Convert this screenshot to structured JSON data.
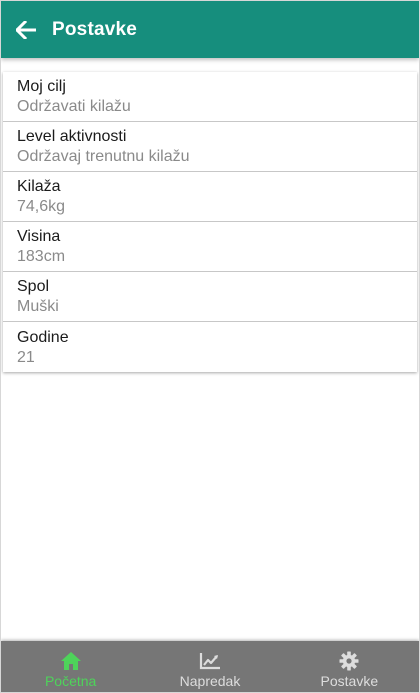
{
  "header": {
    "title": "Postavke",
    "back_icon": "arrow-left-icon"
  },
  "settings": [
    {
      "label": "Moj cilj",
      "value": "Održavati kilažu"
    },
    {
      "label": "Level aktivnosti",
      "value": "Održavaj trenutnu kilažu"
    },
    {
      "label": "Kilaža",
      "value": "74,6kg"
    },
    {
      "label": "Visina",
      "value": "183cm"
    },
    {
      "label": "Spol",
      "value": "Muški"
    },
    {
      "label": "Godine",
      "value": "21"
    }
  ],
  "bottom_nav": [
    {
      "label": "Početna",
      "icon": "home-icon",
      "active": true
    },
    {
      "label": "Napredak",
      "icon": "chart-line-icon",
      "active": false
    },
    {
      "label": "Postavke",
      "icon": "gear-icon",
      "active": false
    }
  ],
  "colors": {
    "primary": "#168e7d",
    "active_nav": "#4ed35a",
    "nav_bg": "#767676"
  }
}
